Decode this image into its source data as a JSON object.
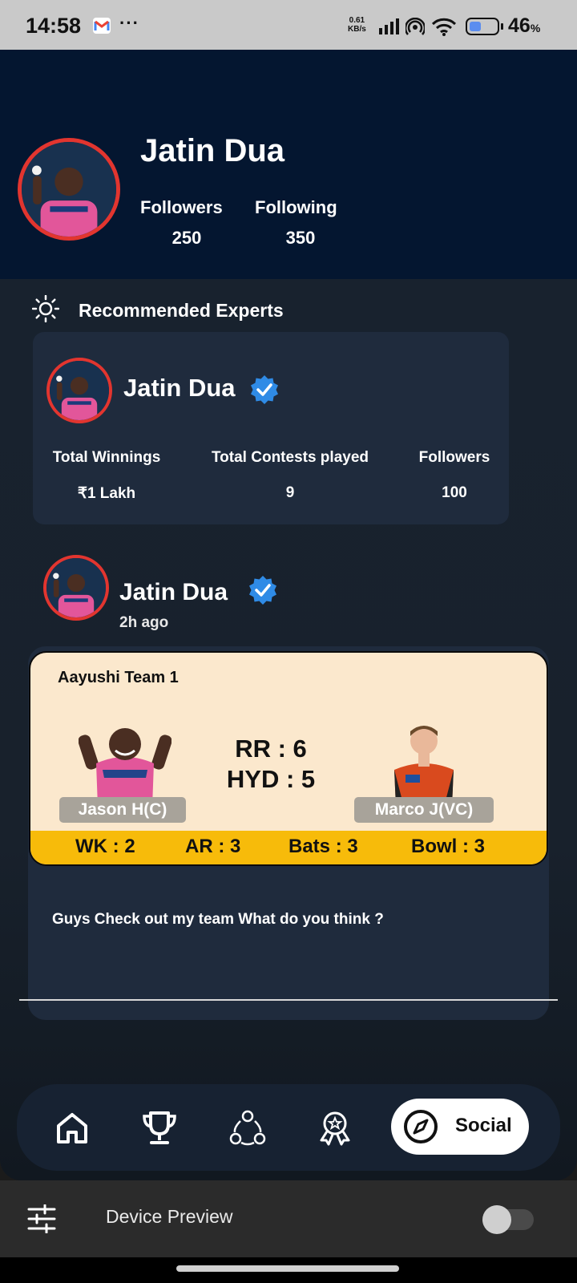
{
  "status_bar": {
    "time": "14:58",
    "notification_icons": [
      "gmail-icon",
      "more-dots-icon"
    ],
    "dots": "···",
    "net_speed_value": "0.61",
    "net_speed_unit": "KB/s",
    "battery_percent": "46",
    "battery_percent_sign": "%",
    "battery_fill": 0.46,
    "system_icons": [
      "signal-icon",
      "hotspot-icon",
      "wifi-icon",
      "battery-icon"
    ]
  },
  "profile": {
    "name": "Jatin Dua",
    "followers_label": "Followers",
    "followers_value": "250",
    "following_label": "Following",
    "following_value": "350"
  },
  "recommended": {
    "title": "Recommended Experts",
    "title_icon": "sun-icon",
    "expert": {
      "name": "Jatin Dua",
      "verified": true,
      "total_winnings_label": "Total Winnings",
      "total_winnings_value": "₹1 Lakh",
      "contests_label": "Total Contests played",
      "contests_value": "9",
      "followers_label": "Followers",
      "followers_value": "100"
    }
  },
  "post": {
    "author": "Jatin Dua",
    "verified": true,
    "time_ago": "2h ago",
    "team": {
      "name": "Aayushi Team 1",
      "score_line_1": "RR : 6",
      "score_line_2": "HYD : 5",
      "captain": "Jason H(C)",
      "vice_captain": "Marco J(VC)",
      "roles": {
        "wk": "WK : 2",
        "ar": "AR : 3",
        "bats": "Bats : 3",
        "bowl": "Bowl : 3"
      }
    },
    "caption": "Guys Check out my team What do you think ?"
  },
  "bottom_nav": {
    "items": [
      {
        "icon": "home-icon"
      },
      {
        "icon": "trophy-icon"
      },
      {
        "icon": "community-icon"
      },
      {
        "icon": "award-badge-icon"
      },
      {
        "icon": "compass-icon",
        "label": "Social",
        "active": true
      }
    ]
  },
  "device_preview": {
    "label": "Device Preview",
    "icon": "sliders-icon",
    "enabled": false
  },
  "colors": {
    "header_bg": "#041630",
    "card_bg": "#1f2b3d",
    "avatar_ring": "#e2352f",
    "verified_blue": "#2f8be6",
    "team_card_bg": "#fbe8cd",
    "role_bar": "#f7bb0a"
  }
}
